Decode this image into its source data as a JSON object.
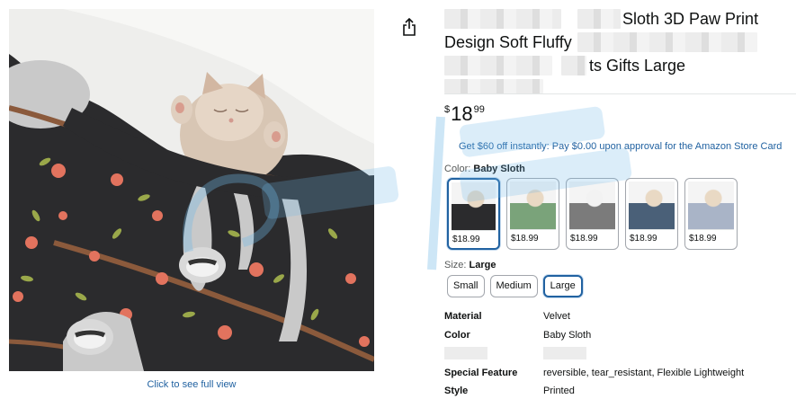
{
  "gallery": {
    "full_view_label": "Click to see full view"
  },
  "actions": {
    "share_icon": "share-icon"
  },
  "title": {
    "line1_visible": "Sloth 3D Paw Print",
    "line2_visible": "Design Soft Fluffy",
    "line3_visible": "ts Gifts Large"
  },
  "price": {
    "symbol": "$",
    "whole": "18",
    "fraction": "99"
  },
  "promo": {
    "text": "Get $60 off instantly: Pay $0.00 upon approval for the Amazon Store Card"
  },
  "color": {
    "label": "Color:",
    "selected": "Baby Sloth",
    "swatches": [
      {
        "price": "$18.99",
        "selected": true
      },
      {
        "price": "$18.99",
        "selected": false
      },
      {
        "price": "$18.99",
        "selected": false
      },
      {
        "price": "$18.99",
        "selected": false
      },
      {
        "price": "$18.99",
        "selected": false
      }
    ]
  },
  "size": {
    "label": "Size:",
    "selected": "Large",
    "options": [
      "Small",
      "Medium",
      "Large"
    ]
  },
  "specs": [
    {
      "key": "Material",
      "value": "Velvet"
    },
    {
      "key": "Color",
      "value": "Baby Sloth"
    },
    {
      "key": "",
      "value": ""
    },
    {
      "key": "Special Feature",
      "value": "reversible, tear_resistant, Flexible Lightweight"
    },
    {
      "key": "Style",
      "value": "Printed"
    }
  ],
  "colors": {
    "link": "#2162a1",
    "selected_border": "#2162a1",
    "blanket_bg": "#2b2b2d"
  }
}
